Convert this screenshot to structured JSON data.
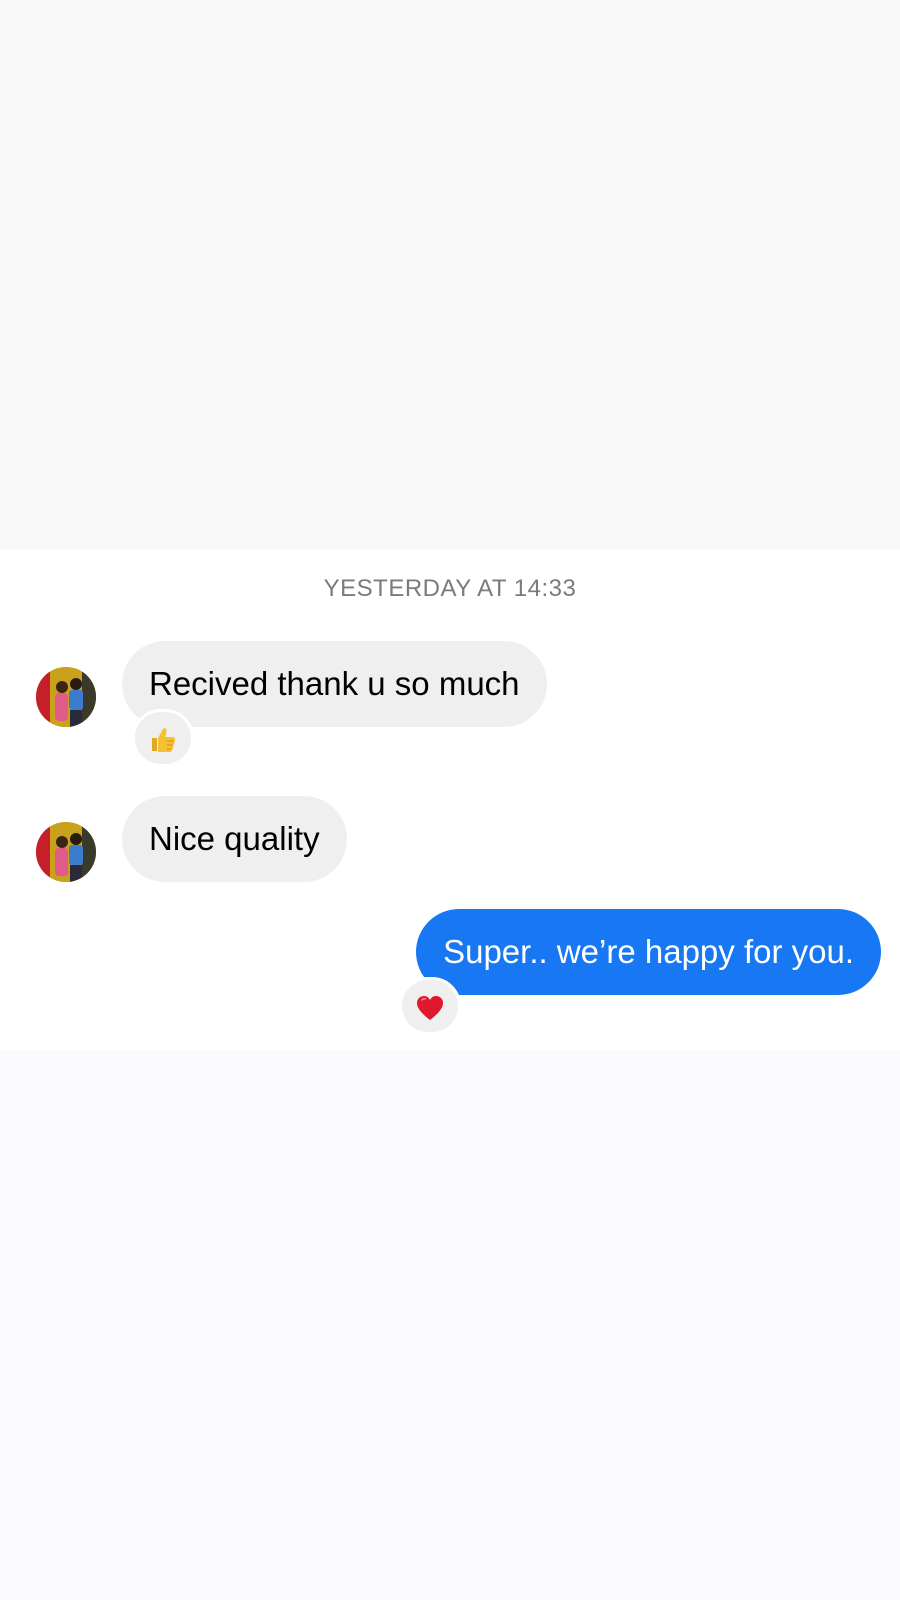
{
  "conversation": {
    "timestamp": "YESTERDAY AT 14:33",
    "messages": [
      {
        "id": "m1",
        "direction": "incoming",
        "text": "Recived thank u so much",
        "reaction": "thumbs-up-icon"
      },
      {
        "id": "m2",
        "direction": "incoming",
        "text": "Nice quality",
        "reaction": null
      },
      {
        "id": "m3",
        "direction": "outgoing",
        "text": "Super.. we’re happy for you.",
        "reaction": "heart-icon"
      }
    ]
  },
  "colors": {
    "outgoing_bubble": "#1877f2",
    "incoming_bubble": "#efefef",
    "timestamp_text": "#7a7a7f",
    "heart": "#e0182d",
    "thumbs_up": "#f5c033"
  },
  "icons": {
    "avatar": "profile-photo",
    "reaction_1": "thumbs-up-icon",
    "reaction_3": "heart-icon"
  }
}
